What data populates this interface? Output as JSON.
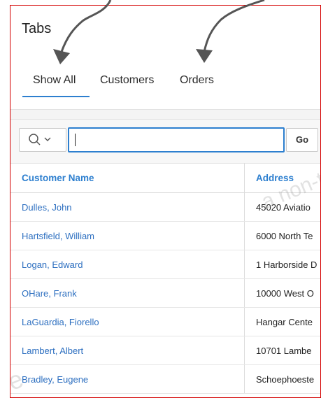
{
  "region": {
    "title": "Tabs"
  },
  "tabs": [
    {
      "label": "Show All",
      "active": true
    },
    {
      "label": "Customers",
      "active": false
    },
    {
      "label": "Orders",
      "active": false
    }
  ],
  "search": {
    "value": "",
    "go_label": "Go",
    "columns_icon": "search-icon",
    "dropdown_icon": "chevron-down-icon"
  },
  "table": {
    "headers": [
      "Customer Name",
      "Address"
    ],
    "rows": [
      [
        "Dulles, John",
        "45020 Aviatio"
      ],
      [
        "Hartsfield, William",
        "6000 North Te"
      ],
      [
        "Logan, Edward",
        "1 Harborside D"
      ],
      [
        "OHare, Frank",
        "10000 West O"
      ],
      [
        "LaGuardia, Fiorello",
        "Hangar Cente"
      ],
      [
        "Lambert, Albert",
        "10701 Lambe"
      ],
      [
        "Bradley, Eugene",
        "Schoephoeste"
      ]
    ]
  },
  "watermark": [
    "a non-transferable lice",
    "ide"
  ],
  "colors": {
    "accent": "#2d7fcf",
    "frame_border": "#d40000",
    "annotation_arrow": "#555555"
  }
}
